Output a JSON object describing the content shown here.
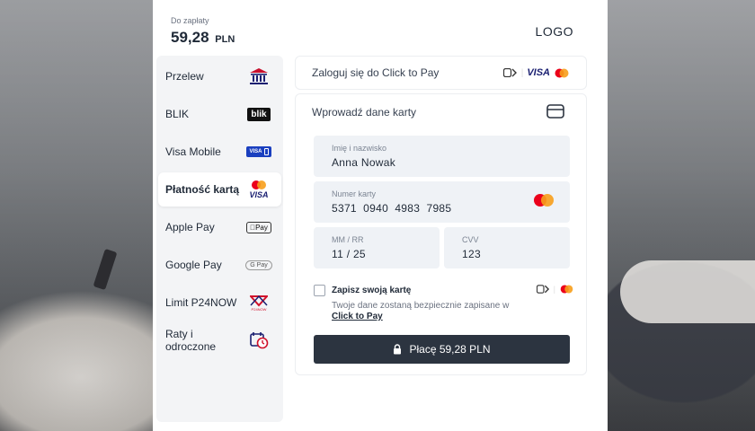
{
  "header": {
    "amount_label": "Do zapłaty",
    "amount_value": "59,28",
    "currency": "PLN",
    "logo": "LOGO"
  },
  "methods": [
    {
      "label": "Przelew",
      "icon": "bank-icon"
    },
    {
      "label": "BLIK",
      "icon": "blik-icon",
      "icon_text": "blik"
    },
    {
      "label": "Visa Mobile",
      "icon": "visa-mobile-icon",
      "icon_text": "VISA"
    },
    {
      "label": "Płatność kartą",
      "icon": "mastercard-visa-icon",
      "icon_text": "VISA",
      "active": true
    },
    {
      "label": "Apple Pay",
      "icon": "apple-pay-icon",
      "icon_text": "Pay"
    },
    {
      "label": "Google Pay",
      "icon": "google-pay-icon",
      "icon_text": "G Pay"
    },
    {
      "label": "Limit P24NOW",
      "icon": "p24now-icon",
      "icon_text": "P24NOW"
    },
    {
      "label": "Raty i odroczone",
      "icon": "calendar-clock-icon"
    }
  ],
  "click_to_pay": {
    "label": "Zaloguj się do Click to Pay",
    "visa_text": "VISA"
  },
  "card_form": {
    "title": "Wprowadź dane karty",
    "name": {
      "label": "Imię i nazwisko",
      "value": "Anna Nowak"
    },
    "number": {
      "label": "Numer karty",
      "value": "5371  0940  4983  7985"
    },
    "expiry": {
      "label": "MM / RR",
      "value": "11 / 25"
    },
    "cvv": {
      "label": "CVV",
      "value": "123"
    },
    "save": {
      "title": "Zapisz swoją kartę",
      "desc_prefix": "Twoje dane zostaną bezpiecznie zapisane w ",
      "desc_link": "Click to Pay",
      "checked": false
    },
    "pay_button": "Płacę 59,28 PLN"
  },
  "colors": {
    "accent": "#2c3440",
    "field_bg": "#eff2f6",
    "mastercard_red": "#eb001b",
    "mastercard_orange": "#f79e1b",
    "visa_blue": "#1a1f71",
    "bank_red": "#c8102e"
  }
}
